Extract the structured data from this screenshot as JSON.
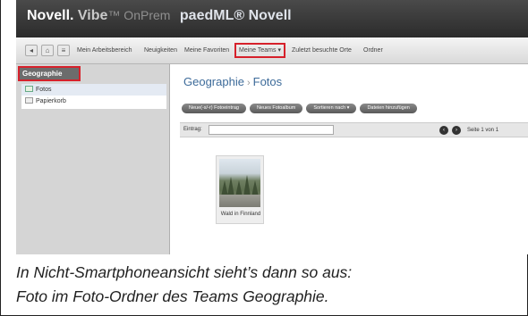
{
  "header": {
    "brand_novell": "Novell.",
    "brand_vibe": "Vibe",
    "brand_onprem": "™ OnPrem",
    "site_name": "paedML® Novell"
  },
  "toolbar": {
    "items": [
      "Mein Arbeitsbereich",
      "Neuigkeiten",
      "Meine Favoriten",
      "Meine Teams",
      "Zuletzt besuchte Orte",
      "Ordner"
    ]
  },
  "sidebar": {
    "title": "Geographie",
    "items": [
      {
        "label": "Fotos",
        "selected": true
      },
      {
        "label": "Papierkorb",
        "selected": false
      }
    ]
  },
  "main": {
    "breadcrumb_root": "Geographie",
    "breadcrumb_sep": "›",
    "breadcrumb_current": "Fotos",
    "actions": [
      "Neue(-s/-r) Fotoeintrag",
      "Neues Fotoalbum",
      "Sortieren nach",
      "Dateien hinzufügen"
    ],
    "entry_label": "Eintrag:",
    "page_info": "Seite 1 von 1",
    "photo_caption": "Wald in Finnland"
  },
  "caption": {
    "line1": "In Nicht-Smartphoneansicht sieht’s dann so aus:",
    "line2": "Foto im Foto-Ordner des Teams Geographie."
  },
  "colors": {
    "highlight": "#d6212b",
    "link": "#3d6b9a"
  }
}
